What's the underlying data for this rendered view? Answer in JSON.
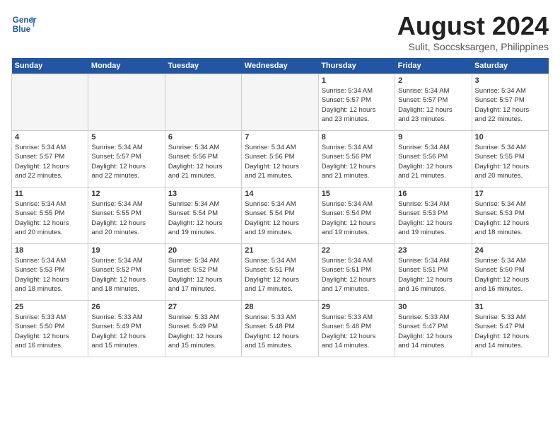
{
  "header": {
    "logo_line1": "General",
    "logo_line2": "Blue",
    "month_title": "August 2024",
    "subtitle": "Sulit, Soccsksargen, Philippines"
  },
  "weekdays": [
    "Sunday",
    "Monday",
    "Tuesday",
    "Wednesday",
    "Thursday",
    "Friday",
    "Saturday"
  ],
  "weeks": [
    [
      {
        "day": "",
        "info": ""
      },
      {
        "day": "",
        "info": ""
      },
      {
        "day": "",
        "info": ""
      },
      {
        "day": "",
        "info": ""
      },
      {
        "day": "1",
        "info": "Sunrise: 5:34 AM\nSunset: 5:57 PM\nDaylight: 12 hours\nand 23 minutes."
      },
      {
        "day": "2",
        "info": "Sunrise: 5:34 AM\nSunset: 5:57 PM\nDaylight: 12 hours\nand 23 minutes."
      },
      {
        "day": "3",
        "info": "Sunrise: 5:34 AM\nSunset: 5:57 PM\nDaylight: 12 hours\nand 22 minutes."
      }
    ],
    [
      {
        "day": "4",
        "info": "Sunrise: 5:34 AM\nSunset: 5:57 PM\nDaylight: 12 hours\nand 22 minutes."
      },
      {
        "day": "5",
        "info": "Sunrise: 5:34 AM\nSunset: 5:57 PM\nDaylight: 12 hours\nand 22 minutes."
      },
      {
        "day": "6",
        "info": "Sunrise: 5:34 AM\nSunset: 5:56 PM\nDaylight: 12 hours\nand 21 minutes."
      },
      {
        "day": "7",
        "info": "Sunrise: 5:34 AM\nSunset: 5:56 PM\nDaylight: 12 hours\nand 21 minutes."
      },
      {
        "day": "8",
        "info": "Sunrise: 5:34 AM\nSunset: 5:56 PM\nDaylight: 12 hours\nand 21 minutes."
      },
      {
        "day": "9",
        "info": "Sunrise: 5:34 AM\nSunset: 5:56 PM\nDaylight: 12 hours\nand 21 minutes."
      },
      {
        "day": "10",
        "info": "Sunrise: 5:34 AM\nSunset: 5:55 PM\nDaylight: 12 hours\nand 20 minutes."
      }
    ],
    [
      {
        "day": "11",
        "info": "Sunrise: 5:34 AM\nSunset: 5:55 PM\nDaylight: 12 hours\nand 20 minutes."
      },
      {
        "day": "12",
        "info": "Sunrise: 5:34 AM\nSunset: 5:55 PM\nDaylight: 12 hours\nand 20 minutes."
      },
      {
        "day": "13",
        "info": "Sunrise: 5:34 AM\nSunset: 5:54 PM\nDaylight: 12 hours\nand 19 minutes."
      },
      {
        "day": "14",
        "info": "Sunrise: 5:34 AM\nSunset: 5:54 PM\nDaylight: 12 hours\nand 19 minutes."
      },
      {
        "day": "15",
        "info": "Sunrise: 5:34 AM\nSunset: 5:54 PM\nDaylight: 12 hours\nand 19 minutes."
      },
      {
        "day": "16",
        "info": "Sunrise: 5:34 AM\nSunset: 5:53 PM\nDaylight: 12 hours\nand 19 minutes."
      },
      {
        "day": "17",
        "info": "Sunrise: 5:34 AM\nSunset: 5:53 PM\nDaylight: 12 hours\nand 18 minutes."
      }
    ],
    [
      {
        "day": "18",
        "info": "Sunrise: 5:34 AM\nSunset: 5:53 PM\nDaylight: 12 hours\nand 18 minutes."
      },
      {
        "day": "19",
        "info": "Sunrise: 5:34 AM\nSunset: 5:52 PM\nDaylight: 12 hours\nand 18 minutes."
      },
      {
        "day": "20",
        "info": "Sunrise: 5:34 AM\nSunset: 5:52 PM\nDaylight: 12 hours\nand 17 minutes."
      },
      {
        "day": "21",
        "info": "Sunrise: 5:34 AM\nSunset: 5:51 PM\nDaylight: 12 hours\nand 17 minutes."
      },
      {
        "day": "22",
        "info": "Sunrise: 5:34 AM\nSunset: 5:51 PM\nDaylight: 12 hours\nand 17 minutes."
      },
      {
        "day": "23",
        "info": "Sunrise: 5:34 AM\nSunset: 5:51 PM\nDaylight: 12 hours\nand 16 minutes."
      },
      {
        "day": "24",
        "info": "Sunrise: 5:34 AM\nSunset: 5:50 PM\nDaylight: 12 hours\nand 16 minutes."
      }
    ],
    [
      {
        "day": "25",
        "info": "Sunrise: 5:33 AM\nSunset: 5:50 PM\nDaylight: 12 hours\nand 16 minutes."
      },
      {
        "day": "26",
        "info": "Sunrise: 5:33 AM\nSunset: 5:49 PM\nDaylight: 12 hours\nand 15 minutes."
      },
      {
        "day": "27",
        "info": "Sunrise: 5:33 AM\nSunset: 5:49 PM\nDaylight: 12 hours\nand 15 minutes."
      },
      {
        "day": "28",
        "info": "Sunrise: 5:33 AM\nSunset: 5:48 PM\nDaylight: 12 hours\nand 15 minutes."
      },
      {
        "day": "29",
        "info": "Sunrise: 5:33 AM\nSunset: 5:48 PM\nDaylight: 12 hours\nand 14 minutes."
      },
      {
        "day": "30",
        "info": "Sunrise: 5:33 AM\nSunset: 5:47 PM\nDaylight: 12 hours\nand 14 minutes."
      },
      {
        "day": "31",
        "info": "Sunrise: 5:33 AM\nSunset: 5:47 PM\nDaylight: 12 hours\nand 14 minutes."
      }
    ]
  ]
}
